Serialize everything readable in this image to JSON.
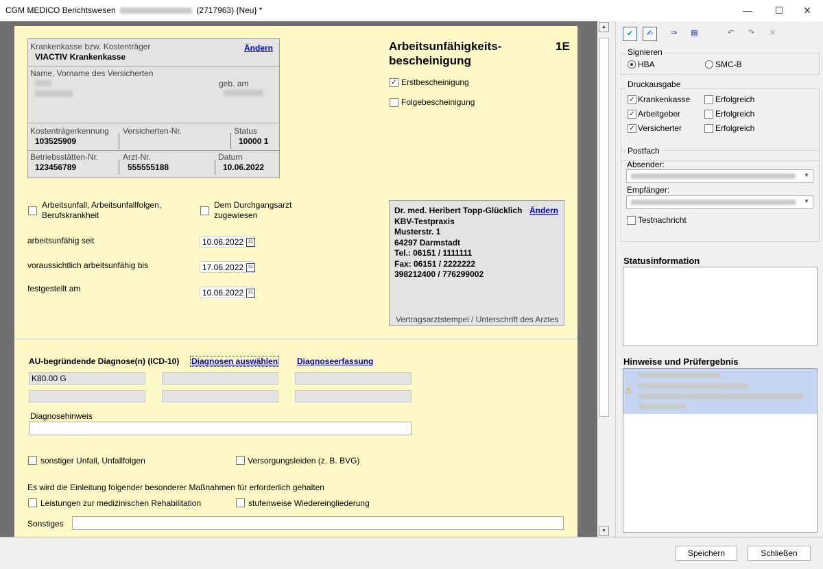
{
  "window": {
    "app_title": "CGM MEDICO Berichtswesen",
    "title_suffix": "(2717963) {Neu} *",
    "minimize": "—",
    "maximize": "☐",
    "close": "✕"
  },
  "form": {
    "kasse_label": "Krankenkasse bzw. Kostenträger",
    "kasse_value": "VIACTIV Krankenkasse",
    "change_link": "Ändern",
    "name_label": "Name, Vorname des Versicherten",
    "geb_label": "geb. am",
    "kostentraeger_label": "Kostenträgerkennung",
    "kostentraeger_value": "103525909",
    "versicherten_nr_label": "Versicherten-Nr.",
    "status_label": "Status",
    "status_value": "10000 1",
    "betriebsstaetten_label": "Betriebsstätten-Nr.",
    "betriebsstaetten_value": "123456789",
    "arzt_nr_label": "Arzt-Nr.",
    "arzt_nr_value": "555555188",
    "datum_label": "Datum",
    "datum_value": "10.06.2022",
    "title_line1": "Arbeitsunfähigkeits-",
    "title_line2": "bescheinigung",
    "form_code": "1E",
    "erstbescheinigung": "Erstbescheinigung",
    "folgebescheinigung": "Folgebescheinigung",
    "arbeitsunfall_line1": "Arbeitsunfall, Arbeitsunfallfolgen,",
    "arbeitsunfall_line2": "Berufskrankheit",
    "durchgangsarzt_line1": "Dem Durchgangsarzt",
    "durchgangsarzt_line2": "zugewiesen",
    "au_seit_label": "arbeitsunfähig seit",
    "au_seit_value": "10.06.2022",
    "au_bis_label": "voraussichtlich arbeitsunfähig bis",
    "au_bis_value": "17.06.2022",
    "festgestellt_label": "festgestellt am",
    "festgestellt_value": "10.06.2022",
    "cal_icon": "31",
    "doctor_name": "Dr. med. Heribert Topp-Glücklich",
    "doctor_change": "Ändern",
    "practice": "KBV-Testpraxis",
    "street": "Musterstr. 1",
    "city": "64297 Darmstadt",
    "tel": "Tel.: 06151 / 1111111",
    "fax": "Fax: 06151 / 2222222",
    "ids": "398212400 / 776299002",
    "stamp_caption": "Vertragsarztstempel / Unterschrift des Arztes",
    "diag_heading": "AU-begründende Diagnose(n) (ICD-10)",
    "diag_select": "Diagnosen auswählen",
    "diag_entry": "Diagnoseerfassung",
    "diag_values": [
      "K80.00 G",
      "",
      "",
      "",
      "",
      ""
    ],
    "diag_hint_label": "Diagnosehinweis",
    "sonstiger_unfall": "sonstiger Unfall, Unfallfolgen",
    "versorgungsleiden": "Versorgungsleiden (z. B. BVG)",
    "massnahmen_text": "Es wird die Einleitung folgender besonderer Maßnahmen für erforderlich gehalten",
    "reha": "Leistungen zur medizinischen Rehabilitation",
    "wiedereingliederung": "stufenweise Wiedereingliederung",
    "sonstiges_label": "Sonstiges"
  },
  "scrollbar": {
    "up": "▲",
    "down": "▼"
  },
  "panel": {
    "toolbar_icons": [
      "sign-check-icon",
      "signature-icon",
      "forward-icon",
      "print-icon",
      "sign-undo-icon",
      "signature-undo-icon",
      "delete-icon"
    ],
    "toolbar_glyphs": [
      "✔",
      "✍",
      "⇒",
      "▤",
      "↶",
      "↷",
      "✕"
    ],
    "signieren_label": "Signieren",
    "hba": "HBA",
    "smcb": "SMC-B",
    "druckausgabe_label": "Druckausgabe",
    "krankenkasse": "Krankenkasse",
    "arbeitgeber": "Arbeitgeber",
    "versicherter": "Versicherter",
    "erfolgreich": "Erfolgreich",
    "postfach_label": "Postfach",
    "absender_label": "Absender:",
    "empfaenger_label": "Empfänger:",
    "testnachricht": "Testnachricht",
    "status_heading": "Statusinformation",
    "hinweise_heading": "Hinweise und Prüfergebnis",
    "warning_icon": "⚠",
    "check": "✓"
  },
  "buttons": {
    "save": "Speichern",
    "close": "Schließen"
  }
}
